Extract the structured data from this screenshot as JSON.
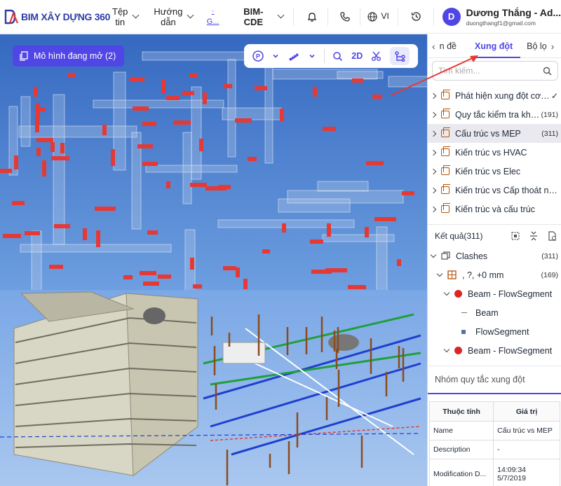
{
  "header": {
    "logo_text": "BIM XÂY DỰNG 360",
    "nav": [
      {
        "label_line1": "Tệp",
        "label_line2": "tin"
      },
      {
        "label_line1": "Hướng",
        "label_line2": "dẫn"
      }
    ],
    "link_text": "· G...",
    "project": "BIM-CDE",
    "language": "VI",
    "user": {
      "initial": "D",
      "name": "Dương Thắng - Ad...",
      "email": "duongthangf1@gmail.com"
    }
  },
  "viewer": {
    "open_models_button": "Mô hình đang mở (2)",
    "toolbar": {
      "p_label": "P",
      "two_d_label": "2D"
    }
  },
  "sidebar": {
    "tabs": [
      {
        "label": "n đề"
      },
      {
        "label": "Xung đột",
        "active": true
      },
      {
        "label": "Bộ lọ"
      }
    ],
    "search_placeholder": "Tìm kiếm...",
    "rules": [
      {
        "label": "Phát hiện xung đột cơ bản",
        "count": "",
        "check": "✓"
      },
      {
        "label": "Quy tắc kiểm tra khoả...",
        "count": "(191)"
      },
      {
        "label": "Cấu trúc vs MEP",
        "count": "(311)",
        "selected": true
      },
      {
        "label": "Kiến trúc vs HVAC",
        "count": ""
      },
      {
        "label": "Kiến trúc vs Elec",
        "count": ""
      },
      {
        "label": "Kiến trúc vs Cấp thoát nước",
        "count": ""
      },
      {
        "label": "Kiến trúc và cấu trúc",
        "count": ""
      }
    ],
    "results": {
      "title": "Kết quả(311)",
      "clashes_label": "Clashes",
      "clashes_count": "(311)",
      "group_label": ", ?, +0 mm",
      "group_count": "(169)",
      "items": [
        {
          "label": "Beam - FlowSegment",
          "children": [
            "Beam",
            "FlowSegment"
          ]
        },
        {
          "label": "Beam - FlowSegment",
          "children": []
        }
      ]
    },
    "rule_group_title": "Nhóm quy tắc xung đột",
    "properties": {
      "headers": [
        "Thuộc tính",
        "Giá trị"
      ],
      "rows": [
        {
          "name": "Name",
          "value": "Cấu trúc vs MEP",
          "value2": ""
        },
        {
          "name": "Description",
          "value": "-",
          "value2": ""
        },
        {
          "name": "Modification D...",
          "value": "14:09:34",
          "value2": "5/7/2019"
        }
      ]
    }
  },
  "colors": {
    "accent": "#4f46e5",
    "clash": "#e53935",
    "brand": "#2f3ea8"
  }
}
